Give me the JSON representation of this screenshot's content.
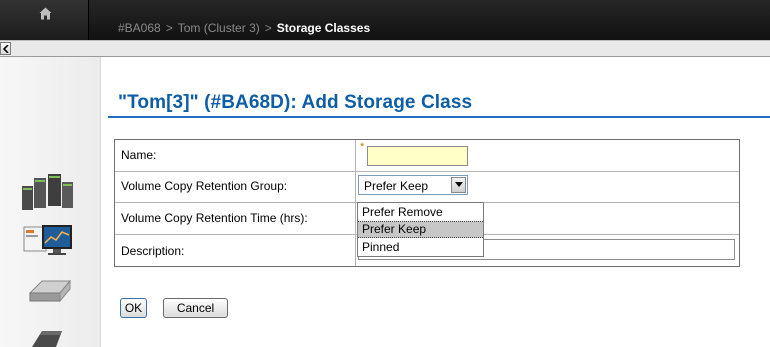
{
  "header": {
    "breadcrumb": {
      "system": "#BA068",
      "cluster": "Tom (Cluster 3)",
      "current": "Storage Classes",
      "separator": ">"
    }
  },
  "page": {
    "title": "\"Tom[3]\" (#BA68D): Add Storage Class"
  },
  "form": {
    "name_label": "Name:",
    "required_marker": "*",
    "name_value": "",
    "retention_group_label": "Volume Copy Retention Group:",
    "retention_group_value": "Prefer Keep",
    "retention_group_options": [
      "Prefer Remove",
      "Prefer Keep",
      "Pinned"
    ],
    "retention_time_label": "Volume Copy Retention Time (hrs):",
    "description_label": "Description:",
    "description_value": ""
  },
  "buttons": {
    "ok": "OK",
    "cancel": "Cancel"
  },
  "colors": {
    "title": "#0e5ea6",
    "header_bg": "#1a1a1a",
    "required_input_bg": "#ffffc8",
    "selected_option_bg": "#c7c7c7"
  },
  "icons": [
    "home-icon",
    "collapse-arrow-icon",
    "server-cluster-icon",
    "monitor-chart-icon",
    "storage-drive-icon",
    "tape-drive-icon",
    "dropdown-arrow-icon"
  ]
}
